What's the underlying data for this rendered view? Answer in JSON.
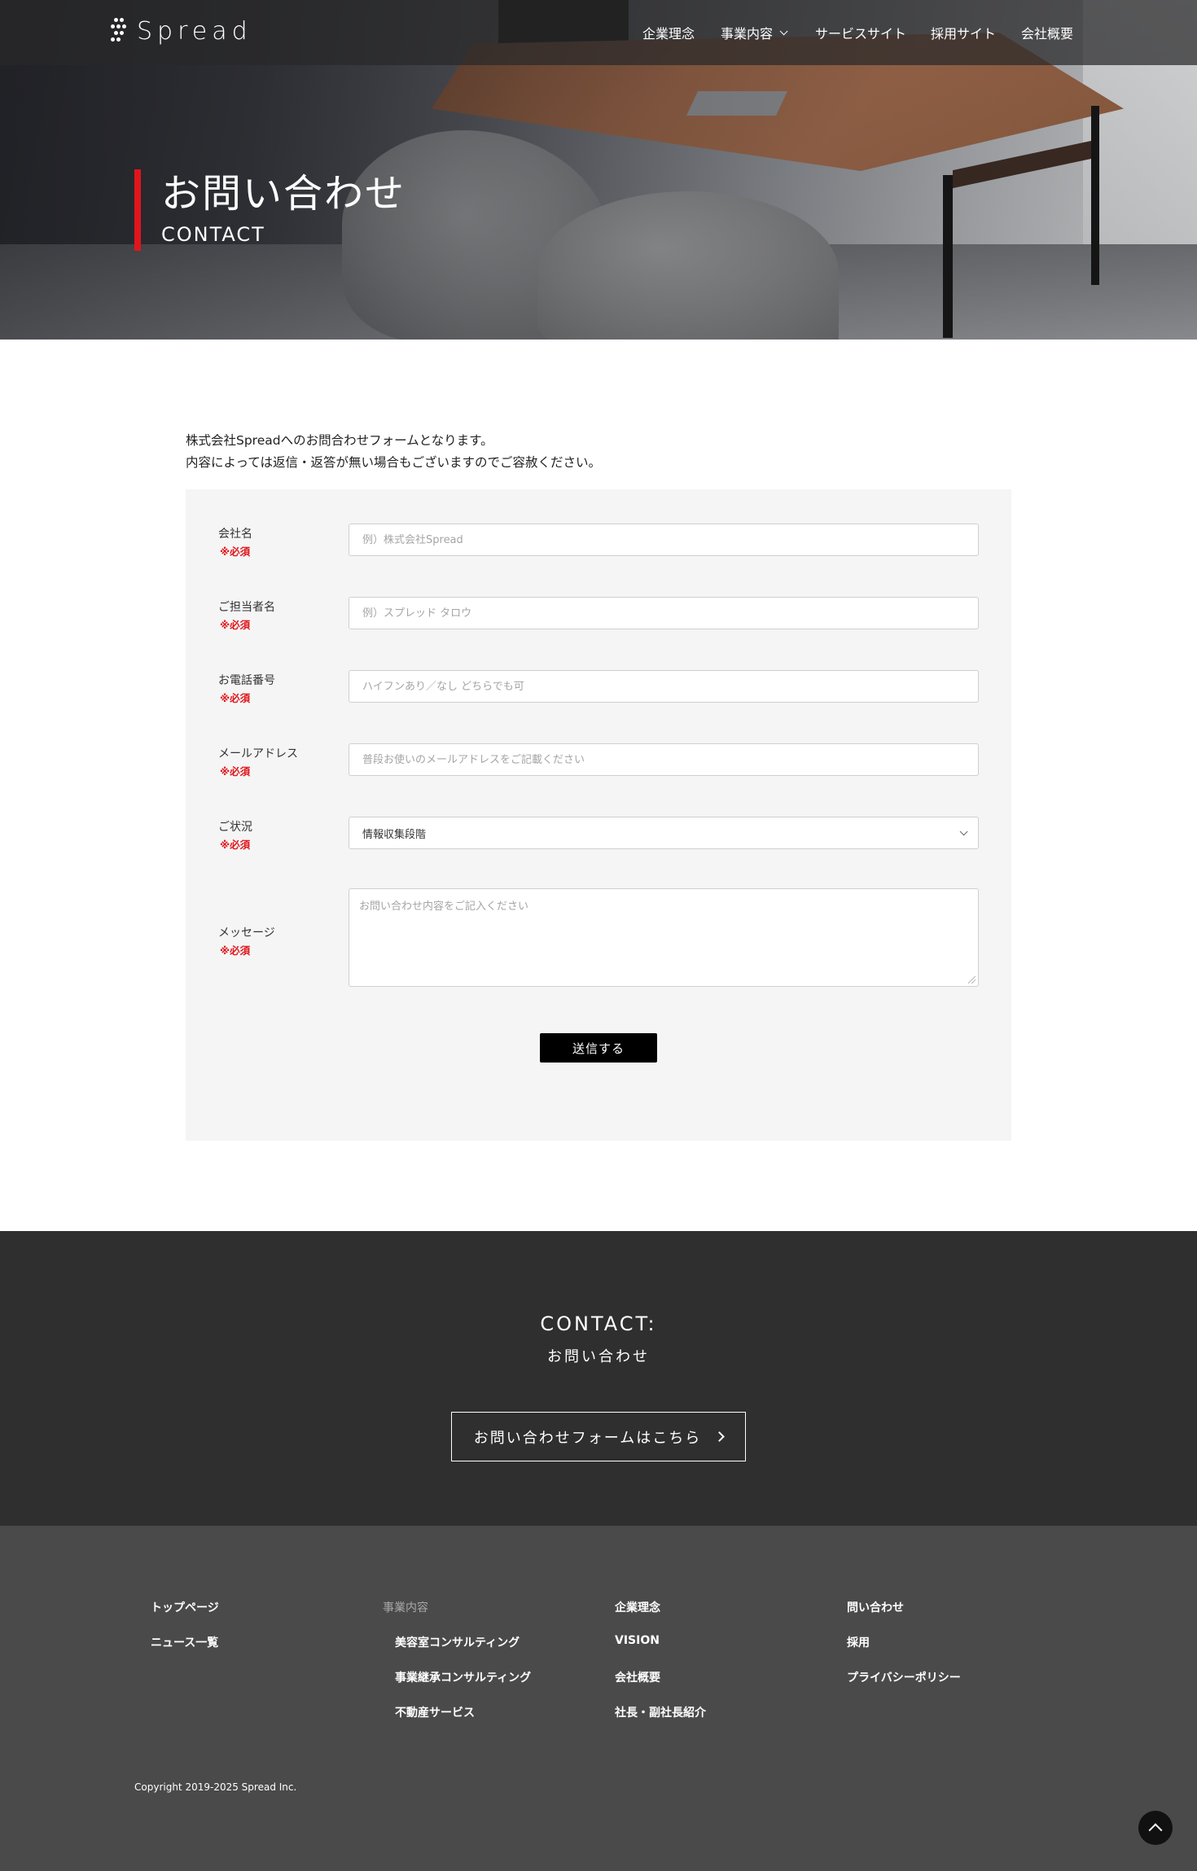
{
  "header": {
    "logo_text": "Spread",
    "nav": [
      {
        "label": "企業理念"
      },
      {
        "label": "事業内容"
      },
      {
        "label": "サービスサイト"
      },
      {
        "label": "採用サイト"
      },
      {
        "label": "会社概要"
      }
    ]
  },
  "hero": {
    "title": "お問い合わせ",
    "subtitle": "CONTACT"
  },
  "intro": {
    "line1": "株式会社Spreadへのお問合わせフォームとなります。",
    "line2": "内容によっては返信・返答が無い場合もございますのでご容赦ください。"
  },
  "form": {
    "required_label": "※必須",
    "fields": [
      {
        "label": "会社名",
        "placeholder": "例）株式会社Spread"
      },
      {
        "label": "ご担当者名",
        "placeholder": "例）スプレッド タロウ"
      },
      {
        "label": "お電話番号",
        "placeholder": "ハイフンあり／なし どちらでも可"
      },
      {
        "label": "メールアドレス",
        "placeholder": "普段お使いのメールアドレスをご記載ください"
      },
      {
        "label": "ご状況",
        "value": "情報収集段階"
      },
      {
        "label": "メッセージ",
        "placeholder": "お問い合わせ内容をご記入ください"
      }
    ],
    "submit_label": "送信する"
  },
  "contact_band": {
    "title_en": "CONTACT:",
    "title_jp": "お問い合わせ",
    "button_label": "お問い合わせフォームはこちら"
  },
  "footer": {
    "col1": [
      "トップページ",
      "ニュース一覧"
    ],
    "col2_heading": "事業内容",
    "col2": [
      "美容室コンサルティング",
      "事業継承コンサルティング",
      "不動産サービス"
    ],
    "col3": [
      "企業理念",
      "VISION",
      "会社概要",
      "社長・副社長紹介"
    ],
    "col4": [
      "問い合わせ",
      "採用",
      "プライバシーポリシー"
    ],
    "copyright": "Copyright 2019-2025 Spread Inc."
  },
  "colors": {
    "accent_red": "#e0161c",
    "contact_band_bg": "#2f2f2f",
    "footer_bg": "#4a4a4a",
    "form_bg": "#f5f5f5"
  },
  "icons": {
    "logo": "logo-mark-icon",
    "dropdown": "chevron-down-icon",
    "cta_arrow": "chevron-right-icon",
    "back_to_top": "chevron-up-icon"
  }
}
